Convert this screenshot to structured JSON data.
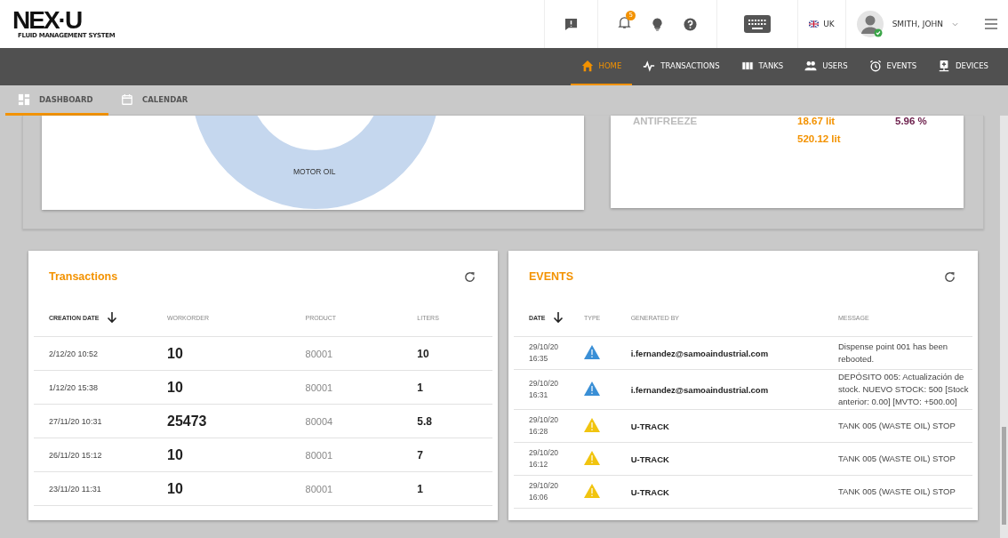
{
  "header": {
    "logo": "NEX·U",
    "logo_subtitle": "FLUID MANAGEMENT SYSTEM",
    "notification_count": "5",
    "language": "UK",
    "user_name": "SMITH, JOHN"
  },
  "nav": [
    {
      "label": "HOME",
      "kind": "home",
      "selected": true
    },
    {
      "label": "TRANSACTIONS",
      "kind": "pulse",
      "selected": false
    },
    {
      "label": "TANKS",
      "kind": "tanks",
      "selected": false
    },
    {
      "label": "USERS",
      "kind": "users",
      "selected": false
    },
    {
      "label": "EVENTS",
      "kind": "clock",
      "selected": false
    },
    {
      "label": "DEVICES",
      "kind": "device",
      "selected": false
    }
  ],
  "subtabs": [
    {
      "label": "DASHBOARD",
      "kind": "grid",
      "selected": true
    },
    {
      "label": "CALENDAR",
      "kind": "calendar",
      "selected": false
    }
  ],
  "product_chart": {
    "slice_label": "MOTOR OIL"
  },
  "stock_summary": {
    "product": "ANTIFREEZE",
    "amount": "18.67 lit",
    "percent": "5.96 %",
    "total": "520.12 lit"
  },
  "transactions": {
    "title": "Transactions",
    "columns": [
      "CREATION DATE",
      "WORKORDER",
      "PRODUCT",
      "LITERS"
    ],
    "rows": [
      {
        "date": "2/12/20 10:52",
        "workorder": "10",
        "product": "80001",
        "liters": "10"
      },
      {
        "date": "1/12/20 15:38",
        "workorder": "10",
        "product": "80001",
        "liters": "1"
      },
      {
        "date": "27/11/20 10:31",
        "workorder": "25473",
        "product": "80004",
        "liters": "5.8"
      },
      {
        "date": "26/11/20 15:12",
        "workorder": "10",
        "product": "80001",
        "liters": "7"
      },
      {
        "date": "23/11/20 11:31",
        "workorder": "10",
        "product": "80001",
        "liters": "1"
      }
    ]
  },
  "events": {
    "title": "EVENTS",
    "columns": [
      "DATE",
      "TYPE",
      "GENERATED BY",
      "MESSAGE"
    ],
    "rows": [
      {
        "date": "29/10/20",
        "time": "16:35",
        "kind": "info",
        "generated_by": "i.fernandez@samoaindustrial.com",
        "message": "Dispense point 001 has been rebooted."
      },
      {
        "date": "29/10/20",
        "time": "16:31",
        "kind": "info",
        "generated_by": "i.fernandez@samoaindustrial.com",
        "message": "DEPÓSITO 005: Actualización de stock. NUEVO STOCK: 500 [Stock anterior: 0.00] [MVTO: +500.00]"
      },
      {
        "date": "29/10/20",
        "time": "16:28",
        "kind": "warning",
        "generated_by": "U-TRACK",
        "message": "TANK 005 (WASTE OIL) STOP"
      },
      {
        "date": "29/10/20",
        "time": "16:12",
        "kind": "warning",
        "generated_by": "U-TRACK",
        "message": "TANK 005 (WASTE OIL) STOP"
      },
      {
        "date": "29/10/20",
        "time": "16:06",
        "kind": "warning",
        "generated_by": "U-TRACK",
        "message": "TANK 005 (WASTE OIL) STOP"
      }
    ]
  }
}
